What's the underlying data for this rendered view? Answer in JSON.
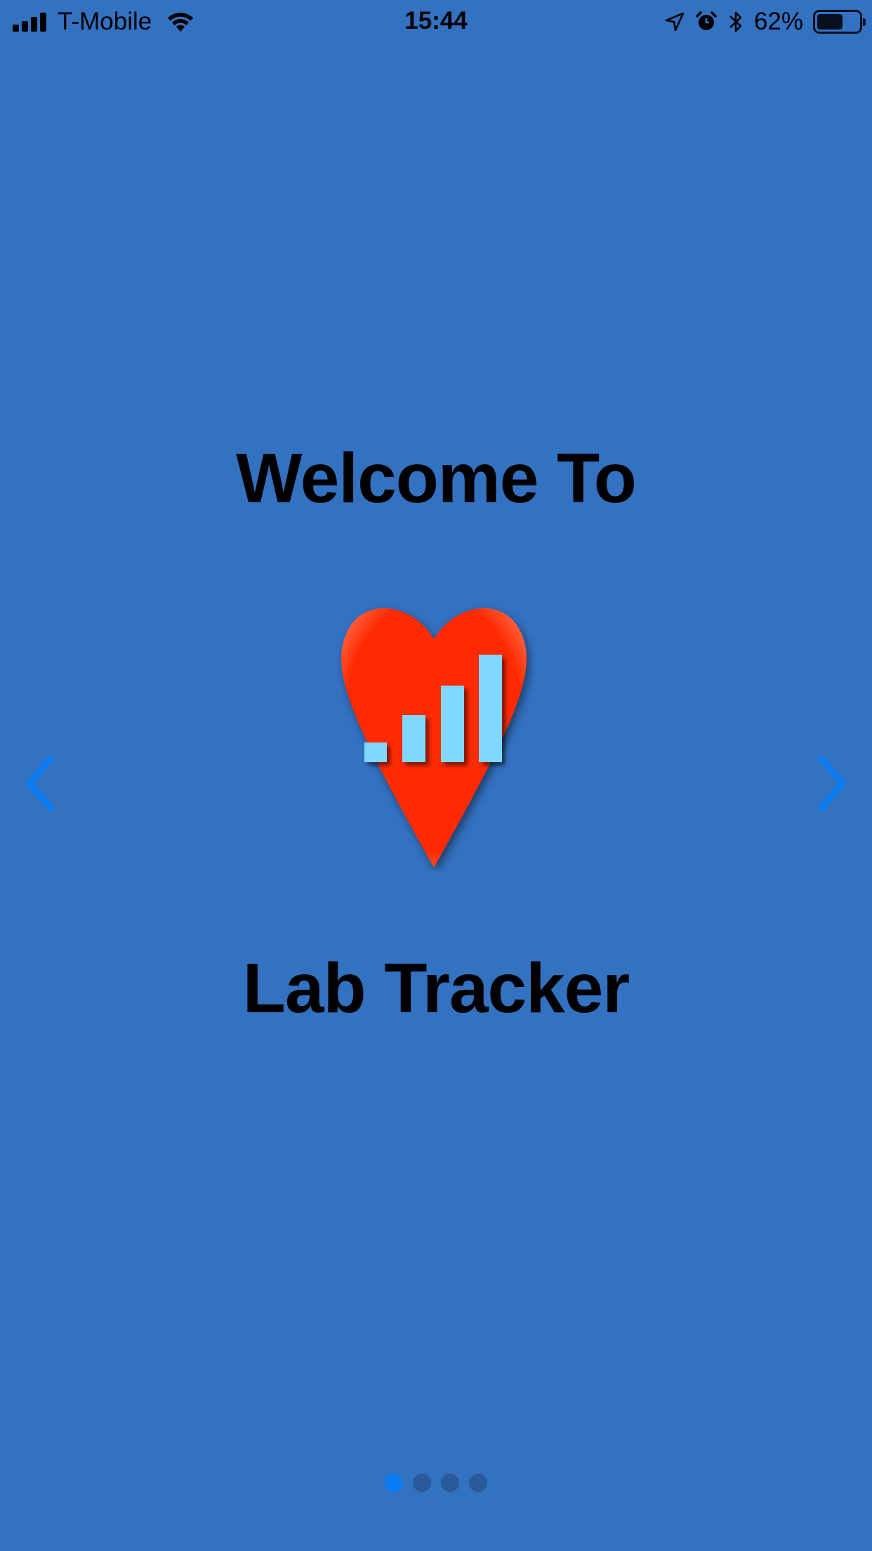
{
  "status_bar": {
    "carrier": "T-Mobile",
    "time": "15:44",
    "battery_percent": "62%",
    "battery_level": 0.62,
    "icons": [
      "signal-icon",
      "wifi-icon",
      "location-icon",
      "alarm-icon",
      "bluetooth-icon",
      "battery-icon"
    ]
  },
  "onboarding": {
    "headline": "Welcome To",
    "app_name": "Lab Tracker",
    "logo": "heart-bar-chart-icon",
    "prev_icon": "chevron-left-icon",
    "next_icon": "chevron-right-icon",
    "page_count": 4,
    "current_page": 1
  },
  "colors": {
    "background": "#3371c1",
    "heart": "#ff2a00",
    "bars": "#7fd8ff",
    "arrow": "#0a7cf3",
    "dot_active": "#0a7cf3",
    "dot_inactive": "#2a5a9a"
  }
}
